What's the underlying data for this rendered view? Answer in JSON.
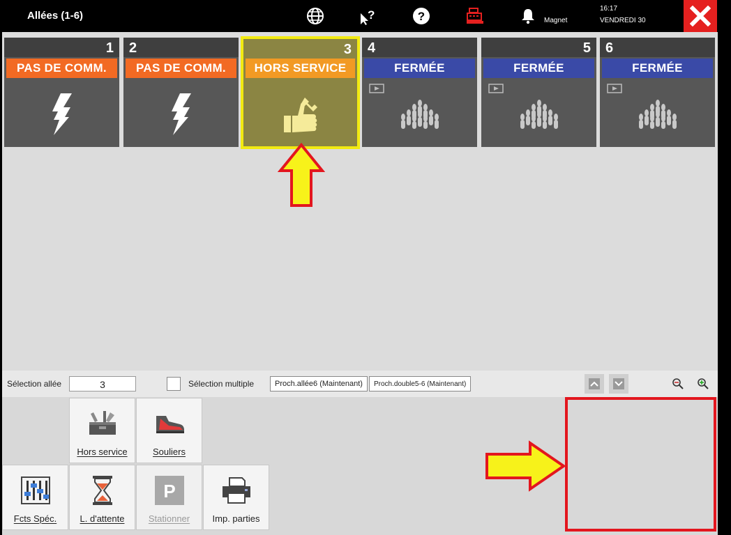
{
  "header": {
    "title": "Allées (1-6)",
    "magnet_label": "Magnet",
    "time": "16:17",
    "day": "VENDREDI 30"
  },
  "lanes": [
    {
      "number": "1",
      "status": "PAS DE COMM.",
      "status_color": "#f26a23",
      "icon": "lightning-icon"
    },
    {
      "number": "2",
      "status": "PAS DE COMM.",
      "status_color": "#f26a23",
      "icon": "lightning-icon"
    },
    {
      "number": "3",
      "status": "HORS SERVICE",
      "status_color": "#f29a24",
      "icon": "thumbs-up-wrench-icon"
    },
    {
      "number": "4",
      "status": "FERMÉE",
      "status_color": "#3a4aa7",
      "icon": "bowling-pins-icon"
    },
    {
      "number": "5",
      "status": "FERMÉE",
      "status_color": "#3a4aa7",
      "icon": "bowling-pins-icon"
    },
    {
      "number": "6",
      "status": "FERMÉE",
      "status_color": "#3a4aa7",
      "icon": "bowling-pins-icon"
    }
  ],
  "selection": {
    "label": "Sélection allée",
    "value": "3",
    "multi_label": "Sélection multiple",
    "next_lane": "Proch.allée6 (Maintenant)",
    "next_double": "Proch.double5-6 (Maintenant)"
  },
  "tools": {
    "out_of_service": "Hors service",
    "shoes": "Souliers",
    "special_functions": "Fcts Spéc.",
    "waiting_list": "L. d'attente",
    "parking": "Stationner",
    "print_games": "Imp. parties"
  },
  "colors": {
    "selected_border": "#f2ea11",
    "close_red": "#e5201f",
    "arrow_fill": "#f7f21a",
    "arrow_stroke": "#e3161e"
  }
}
